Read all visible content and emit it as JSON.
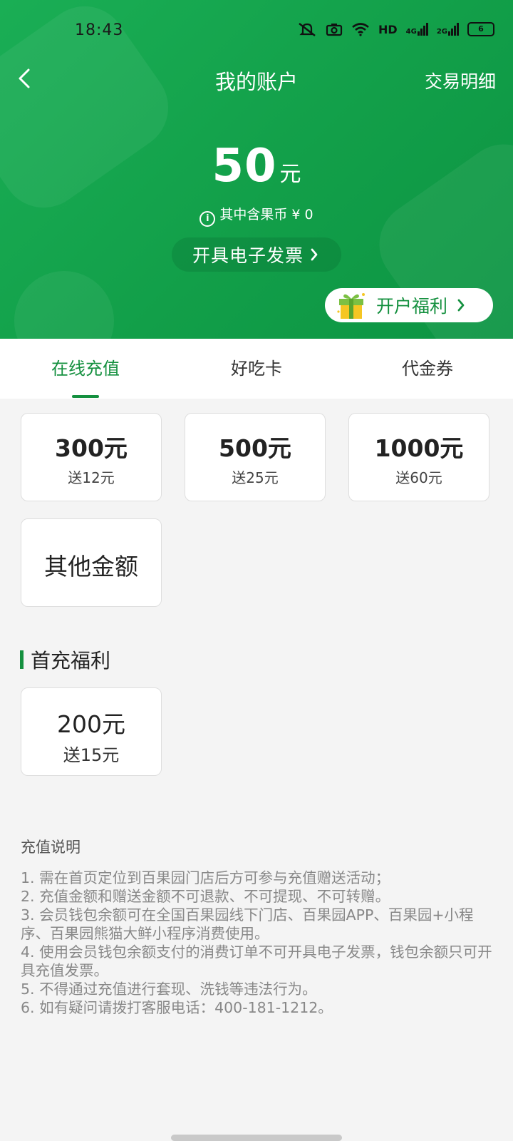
{
  "status_bar": {
    "time": "18:43",
    "network_label": "HD",
    "signal1_label": "4G",
    "signal2_label": "2G",
    "battery_level": "6"
  },
  "nav": {
    "title": "我的账户",
    "right_link": "交易明细",
    "back_icon": "chevron-left-icon"
  },
  "balance": {
    "amount": "50",
    "unit": "元",
    "note": "其中含果币 ¥ 0"
  },
  "invoice_button": "开具电子发票",
  "gift_button": "开户福利",
  "tabs": [
    {
      "label": "在线充值",
      "active": true
    },
    {
      "label": "好吃卡",
      "active": false
    },
    {
      "label": "代金券",
      "active": false
    }
  ],
  "recharge_options": [
    {
      "amount": "300元",
      "bonus": "送12元"
    },
    {
      "amount": "500元",
      "bonus": "送25元"
    },
    {
      "amount": "1000元",
      "bonus": "送60元"
    }
  ],
  "other_amount_label": "其他金额",
  "first_recharge": {
    "title": "首充福利",
    "option": {
      "amount": "200元",
      "bonus": "送15元"
    }
  },
  "notes": {
    "title": "充值说明",
    "lines": [
      "1. 需在首页定位到百果园门店后方可参与充值赠送活动；",
      "2. 充值金额和赠送金额不可退款、不可提现、不可转赠。",
      "3. 会员钱包余额可在全国百果园线下门店、百果园APP、百果园+小程序、百果园熊猫大鲜小程序消费使用。",
      "4. 使用会员钱包余额支付的消费订单不可开具电子发票，钱包余额只可开具充值发票。",
      "5. 不得通过充值进行套现、洗钱等违法行为。",
      "6. 如有疑问请拨打客服电话：400-181-1212。"
    ]
  },
  "colors": {
    "brand_green": "#14903f",
    "header_green": "#129f49"
  }
}
